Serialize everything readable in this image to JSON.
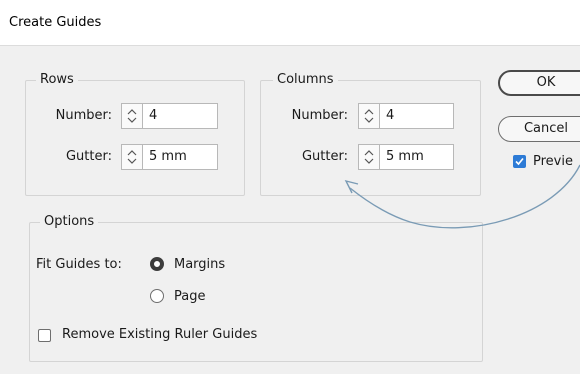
{
  "dialog": {
    "title": "Create Guides"
  },
  "rows": {
    "legend": "Rows",
    "number_label": "Number:",
    "number_value": "4",
    "gutter_label": "Gutter:",
    "gutter_value": "5 mm"
  },
  "columns": {
    "legend": "Columns",
    "number_label": "Number:",
    "number_value": "4",
    "gutter_label": "Gutter:",
    "gutter_value": "5 mm"
  },
  "options": {
    "legend": "Options",
    "fit_label": "Fit Guides to:",
    "fit_options": [
      {
        "label": "Margins",
        "selected": true
      },
      {
        "label": "Page",
        "selected": false
      }
    ],
    "remove_label": "Remove Existing Ruler Guides",
    "remove_checked": false
  },
  "buttons": {
    "ok_label": "OK",
    "cancel_label": "Cancel"
  },
  "preview": {
    "label": "Previe",
    "checked": true
  },
  "colors": {
    "accent": "#2d7bd6",
    "arrow": "#7a9bb5"
  },
  "icons": {
    "stepper": "up-down-chevron-icon",
    "check": "checkmark-icon",
    "arrow": "curved-arrow-annotation-icon"
  }
}
